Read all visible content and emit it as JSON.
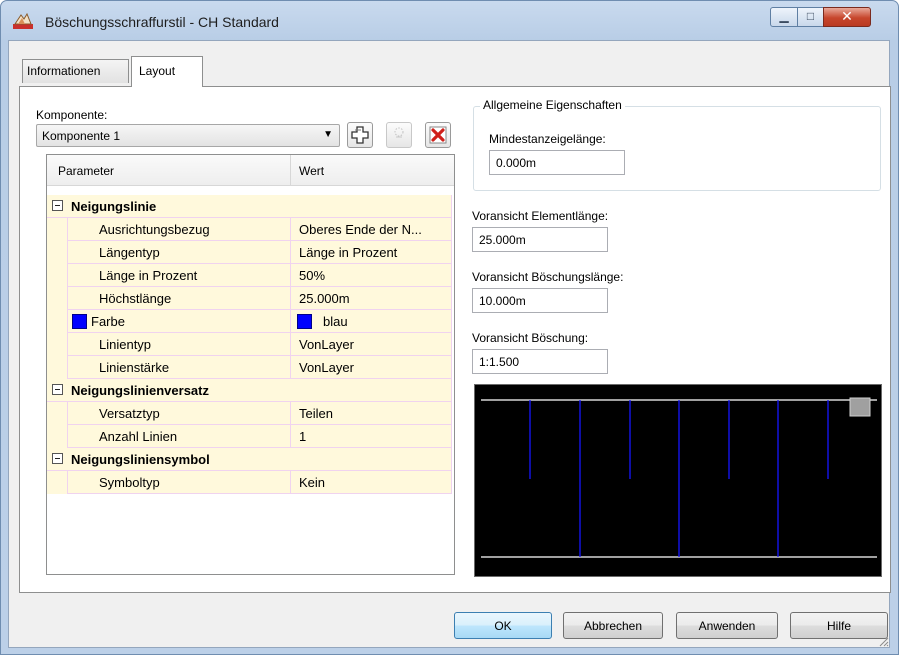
{
  "window": {
    "title": "Böschungsschraffurstil - CH Standard",
    "controls": {
      "minimize": "▁",
      "maximize": "□",
      "close": "✕"
    }
  },
  "tabs": [
    {
      "label": "Informationen",
      "active": false
    },
    {
      "label": "Layout",
      "active": true
    }
  ],
  "component": {
    "label": "Komponente:",
    "selected": "Komponente 1",
    "buttons": {
      "add": "plus-icon",
      "copy": "copy-icon",
      "delete": "delete-icon"
    }
  },
  "grid": {
    "headers": [
      "Parameter",
      "Wert"
    ],
    "rows": [
      {
        "type": "category",
        "param": "Neigungslinie",
        "value": ""
      },
      {
        "type": "prop",
        "param": "Ausrichtungsbezug",
        "value": "Oberes Ende der N..."
      },
      {
        "type": "prop",
        "param": "Längentyp",
        "value": "Länge in Prozent"
      },
      {
        "type": "prop",
        "param": "Länge in Prozent",
        "value": "50%"
      },
      {
        "type": "prop",
        "param": "Höchstlänge",
        "value": "25.000m"
      },
      {
        "type": "color",
        "param": "Farbe",
        "value": "blau",
        "color": "#0000ff"
      },
      {
        "type": "prop",
        "param": "Linientyp",
        "value": "VonLayer"
      },
      {
        "type": "prop",
        "param": "Linienstärke",
        "value": "VonLayer"
      },
      {
        "type": "category",
        "param": "Neigungslinienversatz",
        "value": ""
      },
      {
        "type": "prop",
        "param": "Versatztyp",
        "value": "Teilen"
      },
      {
        "type": "prop",
        "param": "Anzahl Linien",
        "value": "1"
      },
      {
        "type": "category",
        "param": "Neigungsliniensymbol",
        "value": ""
      },
      {
        "type": "prop",
        "param": "Symboltyp",
        "value": "Kein"
      }
    ]
  },
  "general": {
    "legend": "Allgemeine Eigenschaften",
    "min_label": "Mindestanzeigelänge:",
    "min_value": "0.000m"
  },
  "preview_fields": {
    "element_label": "Voransicht Elementlänge:",
    "element_value": "25.000m",
    "slope_len_label": "Voransicht Böschungslänge:",
    "slope_len_value": "10.000m",
    "slope_label": "Voransicht Böschung:",
    "slope_value": "1:1.500"
  },
  "preview": {
    "background": "#000000",
    "line_color": "#0000ff",
    "edge_color": "#ffffff"
  },
  "buttons": {
    "ok": "OK",
    "cancel": "Abbrechen",
    "apply": "Anwenden",
    "help": "Hilfe"
  }
}
